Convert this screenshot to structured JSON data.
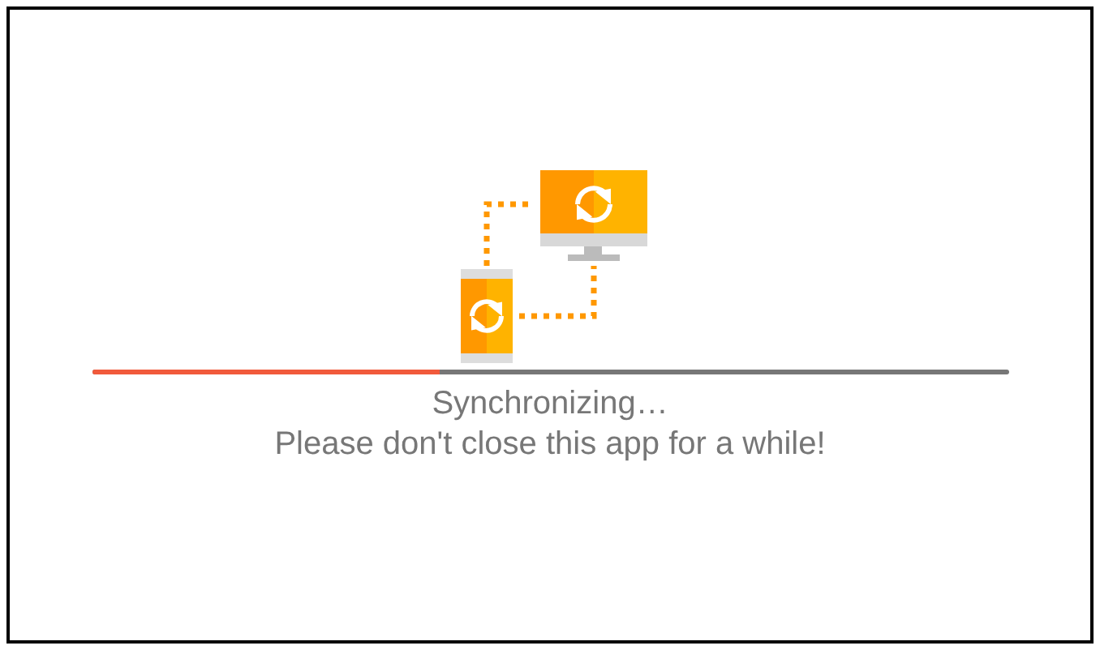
{
  "progress": {
    "level": 0.38
  },
  "status": "Synchronizing…",
  "message": "Please don't close this app for a while!"
}
